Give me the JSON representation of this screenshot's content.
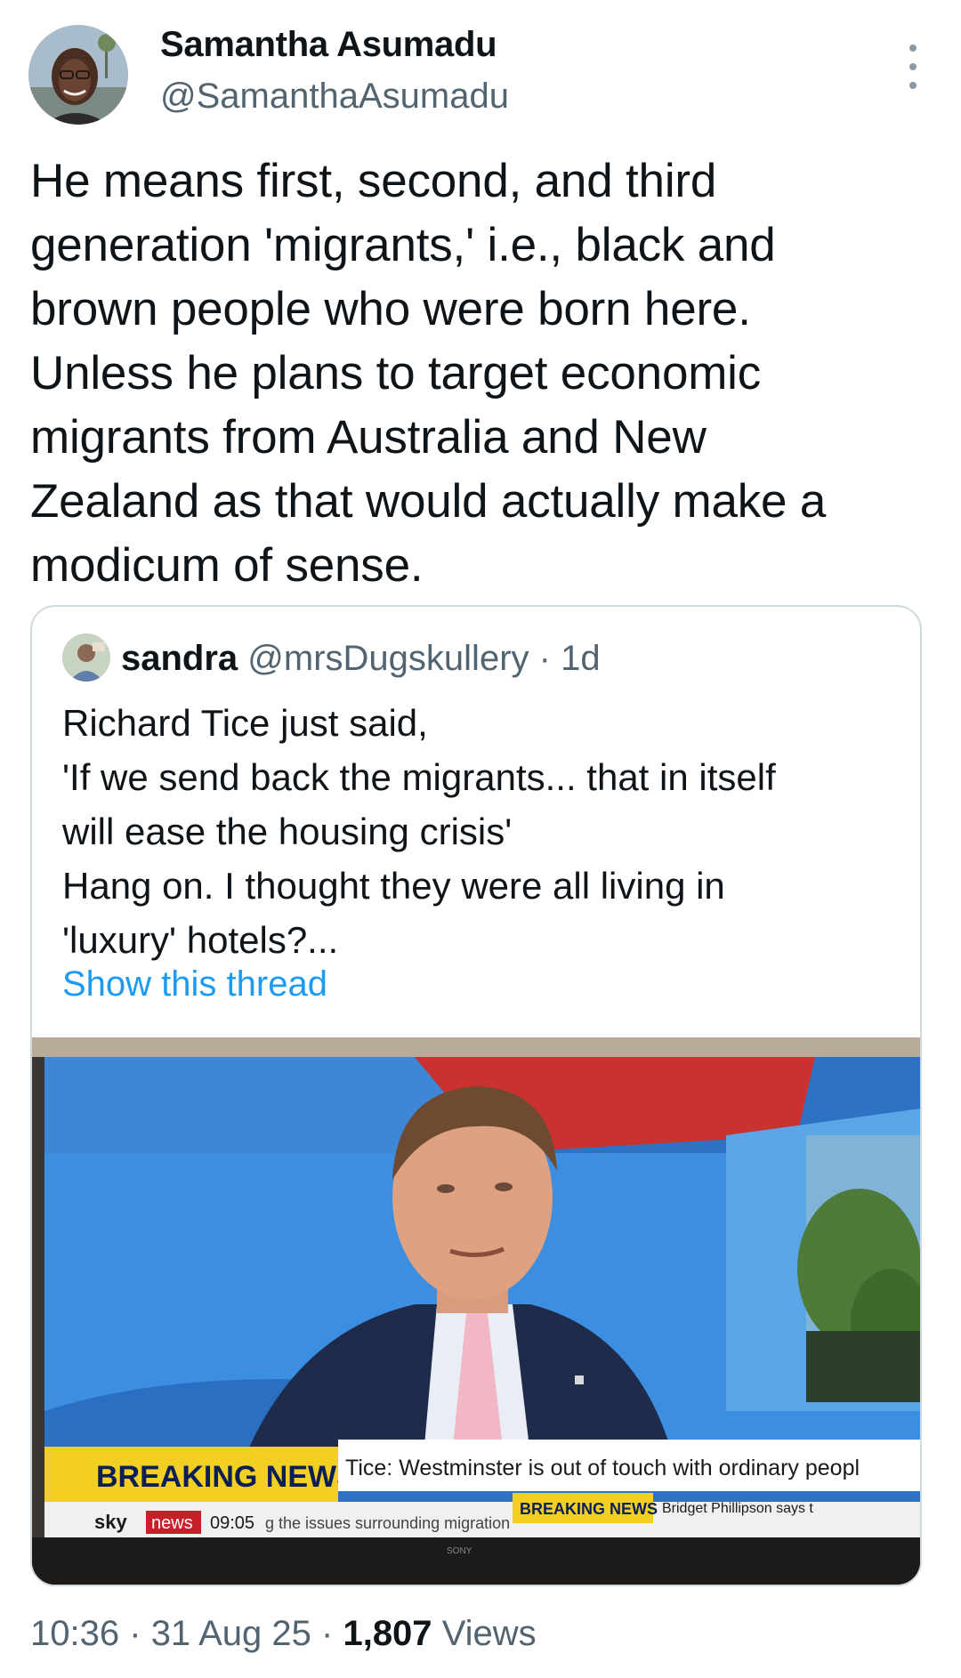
{
  "author": {
    "name": "Samantha Asumadu",
    "handle": "@SamanthaAsumadu",
    "avatar_icon": "profile-photo-icon"
  },
  "tweet": {
    "text": "He means first, second, and third\ngeneration 'migrants,' i.e., black and\nbrown people who were born here.\nUnless he plans to target economic\nmigrants from Australia and New\nZealand as that would actually make a\nmodicum of sense."
  },
  "quoted": {
    "name": "sandra",
    "handle": "@mrsDugskullery",
    "separator": "·",
    "time": "1d",
    "text": "Richard Tice just said,\n'If we send back the migrants... that in itself\nwill ease the housing crisis'\nHang on. I thought they were all living in\n'luxury' hotels?...",
    "show_thread": "Show this thread",
    "media": {
      "breaking_news": "BREAKING NEWS",
      "headline": "Tice: Westminster is out of touch with ordinary peopl",
      "channel_sky": "sky",
      "channel_news": "news",
      "clock": "09:05",
      "crawl": "g the issues surrounding migration",
      "badge": "BREAKING NEWS",
      "next_item": "Bridget Phillipson says t",
      "tv_brand": "SONY"
    }
  },
  "meta": {
    "time": "10:36",
    "sep1": "·",
    "date": "31 Aug 25",
    "sep2": "·",
    "views": "1,807",
    "views_label": "Views"
  }
}
